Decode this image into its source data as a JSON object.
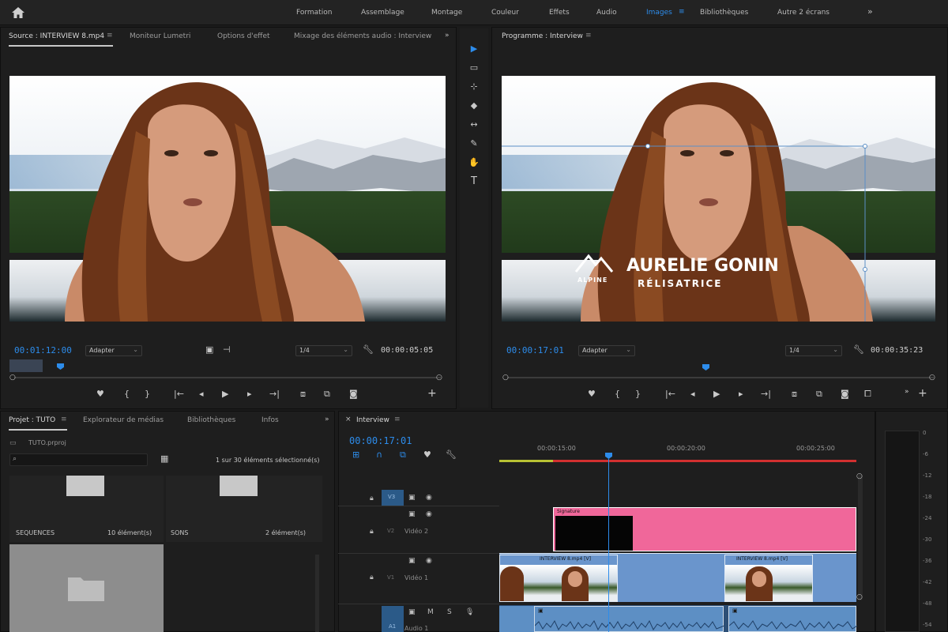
{
  "workspaces": {
    "items": [
      "Formation",
      "Assemblage",
      "Montage",
      "Couleur",
      "Effets",
      "Audio",
      "Images",
      "Bibliothèques",
      "Autre 2 écrans"
    ],
    "active": "Images",
    "more": "»"
  },
  "source_panel": {
    "tabs": [
      "Source : INTERVIEW 8.mp4",
      "Moniteur Lumetri",
      "Options d'effet",
      "Mixage des éléments audio : Interview"
    ],
    "timecode": "00:01:12:00",
    "fit": "Adapter",
    "resolution": "1/4",
    "duration": "00:00:05:05"
  },
  "program_panel": {
    "tab": "Programme : Interview",
    "timecode": "00:00:17:01",
    "fit": "Adapter",
    "resolution": "1/4",
    "duration": "00:00:35:23",
    "lower_third": {
      "logo_text": "ALPINE",
      "title": "AURELIE GONIN",
      "subtitle": "RÉLISATRICE"
    }
  },
  "project_panel": {
    "tabs": [
      "Projet : TUTO",
      "Explorateur de médias",
      "Bibliothèques",
      "Infos"
    ],
    "file": "TUTO.prproj",
    "search_placeholder": "",
    "selection_info": "1 sur 30 éléments sélectionné(s)",
    "bins": [
      {
        "name": "SEQUENCES",
        "count": "10 élément(s)"
      },
      {
        "name": "SONS",
        "count": "2 élément(s)"
      }
    ]
  },
  "timeline": {
    "tab": "Interview",
    "timecode": "00:00:17:01",
    "ruler": [
      "00:00:15:00",
      "00:00:20:00",
      "00:00:25:00"
    ],
    "tracks": [
      {
        "id": "V3",
        "name": ""
      },
      {
        "id": "V2",
        "name": "Vidéo 2"
      },
      {
        "id": "V1",
        "name": "Vidéo 1"
      },
      {
        "id": "A1",
        "name": "Audio 1"
      }
    ],
    "clips": {
      "graphic": "Signature",
      "video_a": "INTERVIEW 8.mp4 [V]",
      "video_b": "INTERVIEW 8.mp4 [V]"
    }
  },
  "meter": {
    "labels": [
      "0",
      "-6",
      "-12",
      "-18",
      "-24",
      "-30",
      "-36",
      "-42",
      "-48",
      "-54"
    ]
  },
  "colors": {
    "accent": "#2d8ceb",
    "graphic_clip": "#f0679a",
    "video_clip": "#6a95cc",
    "audio_clip": "#5d8fc4"
  }
}
